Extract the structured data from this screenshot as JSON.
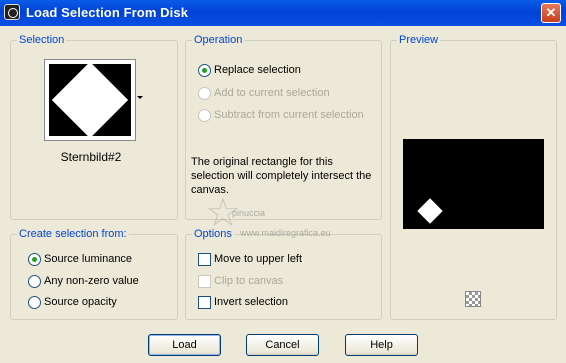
{
  "window": {
    "title": "Load Selection From Disk",
    "close_label": "✕"
  },
  "selection": {
    "title": "Selection",
    "thumbnail_name": "Sternbild#2"
  },
  "operation": {
    "title": "Operation",
    "options": [
      {
        "label": "Replace selection",
        "selected": true,
        "enabled": true
      },
      {
        "label": "Add to current selection",
        "selected": false,
        "enabled": false
      },
      {
        "label": "Subtract from current selection",
        "selected": false,
        "enabled": false
      }
    ],
    "info_text": "The original rectangle for this selection will completely intersect the canvas."
  },
  "preview": {
    "title": "Preview"
  },
  "create_from": {
    "title": "Create selection from:",
    "options": [
      {
        "label": "Source luminance",
        "selected": true
      },
      {
        "label": "Any non-zero value",
        "selected": false
      },
      {
        "label": "Source opacity",
        "selected": false
      }
    ]
  },
  "options": {
    "title": "Options",
    "items": [
      {
        "label": "Move to upper left",
        "checked": false,
        "enabled": true
      },
      {
        "label": "Clip to canvas",
        "checked": false,
        "enabled": false
      },
      {
        "label": "Invert selection",
        "checked": false,
        "enabled": true
      }
    ]
  },
  "buttons": {
    "load": "Load",
    "cancel": "Cancel",
    "help": "Help"
  },
  "watermark": {
    "line1": "pinuccia",
    "line2": "www.maidiregrafica.eu"
  },
  "colors": {
    "titlebar": "#0a4ee3",
    "group_title": "#0046d5",
    "radio_dot": "#21a121",
    "face": "#ece9d8"
  }
}
